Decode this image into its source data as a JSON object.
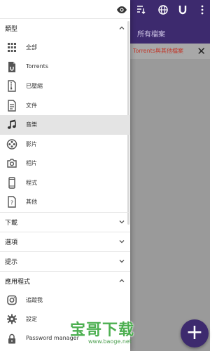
{
  "background_app": {
    "toolbar_title": "所有檔案",
    "banner_text": "Torrents與其他檔案",
    "colors": {
      "toolbar": "#3d2a6e",
      "dim": "#9a9a9a"
    }
  },
  "drawer": {
    "sections": {
      "categories": {
        "title": "類型",
        "expanded": true
      },
      "downloads": {
        "title": "下載",
        "expanded": false
      },
      "options": {
        "title": "選項",
        "expanded": false
      },
      "tips": {
        "title": "提示",
        "expanded": false
      },
      "apps": {
        "title": "應用程式",
        "expanded": true
      }
    },
    "category_items": [
      {
        "label": "全部",
        "icon": "grid-icon"
      },
      {
        "label": "Torrents",
        "icon": "torrent-file-icon"
      },
      {
        "label": "已壓縮",
        "icon": "zip-file-icon"
      },
      {
        "label": "文件",
        "icon": "document-icon"
      },
      {
        "label": "音樂",
        "icon": "music-note-icon"
      },
      {
        "label": "影片",
        "icon": "film-reel-icon"
      },
      {
        "label": "相片",
        "icon": "photo-icon"
      },
      {
        "label": "程式",
        "icon": "phone-icon"
      },
      {
        "label": "其他",
        "icon": "unknown-file-icon"
      }
    ],
    "selected_category": "音樂",
    "app_items": [
      {
        "label": "追蹤我",
        "icon": "instagram-icon"
      },
      {
        "label": "設定",
        "icon": "gear-icon"
      },
      {
        "label": "Password manager",
        "icon": "lock-icon"
      }
    ]
  },
  "watermark": {
    "title": "宝哥下载",
    "url": "www.baoge.net"
  }
}
